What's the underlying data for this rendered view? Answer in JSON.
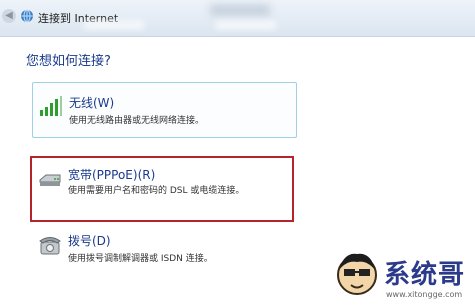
{
  "window": {
    "title": "连接到 Internet"
  },
  "main": {
    "heading": "您想如何连接?"
  },
  "options": [
    {
      "title": "无线(W)",
      "description": "使用无线路由器或无线网络连接。",
      "icon": "wireless-signal-icon"
    },
    {
      "title": "宽带(PPPoE)(R)",
      "description": "使用需要用户名和密码的 DSL 或电缆连接。",
      "icon": "modem-icon"
    },
    {
      "title": "拨号(D)",
      "description": "使用拨号调制解调器或 ISDN 连接。",
      "icon": "telephone-icon"
    }
  ],
  "watermark": {
    "brand": "系统哥",
    "url": "www.xitongge.com"
  },
  "colors": {
    "heading": "#1a3a8b",
    "highlight_border": "#b5242a",
    "selected_border": "#9fd0e8"
  }
}
